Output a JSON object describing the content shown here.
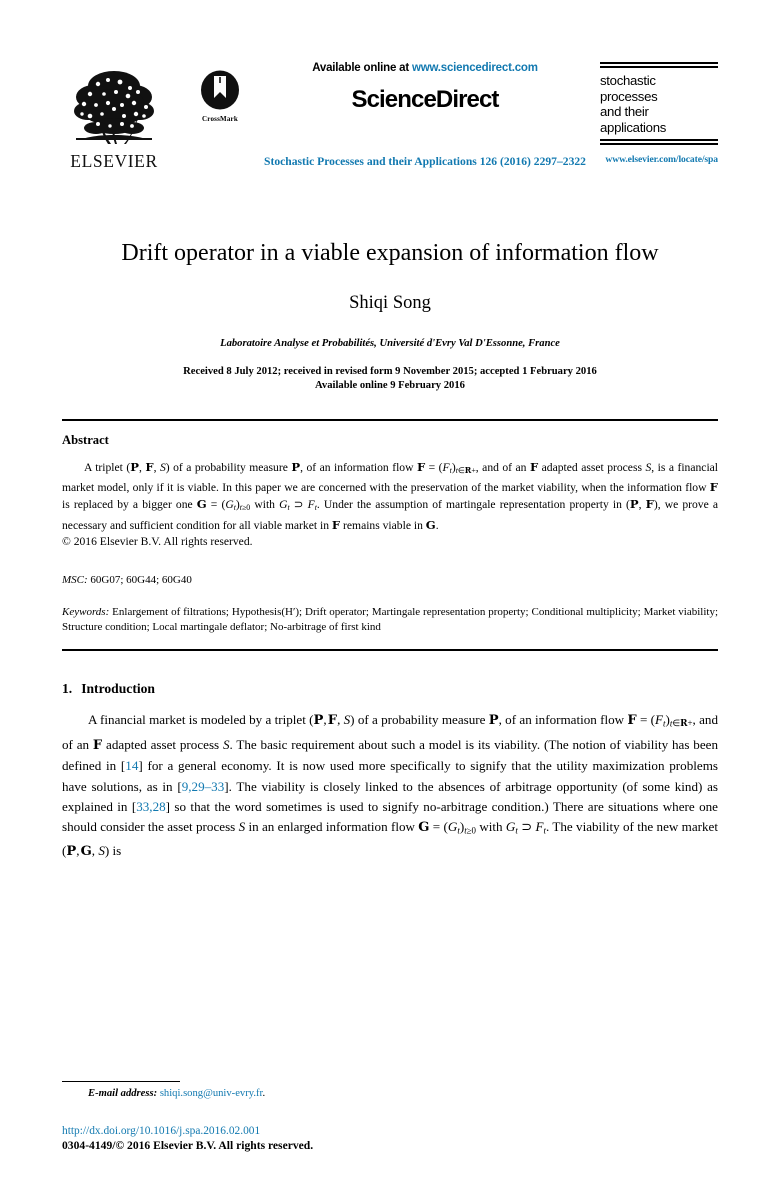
{
  "masthead": {
    "publisher_name": "ELSEVIER",
    "publisher_logo_icon": "elsevier-tree-logo",
    "crossmark_label": "CrossMark",
    "crossmark_icon": "crossmark-logo",
    "available_online_prefix": "Available online at ",
    "sciencedirect_url": "www.sciencedirect.com",
    "sciencedirect_logo": "ScienceDirect",
    "journal_ref": "Stochastic Processes and their Applications 126 (2016) 2297–2322",
    "journal_box_title": "stochastic processes and their applications",
    "journal_box_lines": [
      "stochastic",
      "processes",
      "and their",
      "applications"
    ],
    "journal_url": "www.elsevier.com/locate/spa"
  },
  "colors": {
    "link_blue": "#1279b0",
    "text_black": "#000000",
    "page_background": "#ffffff"
  },
  "title_block": {
    "title": "Drift operator in a viable expansion of information flow",
    "author": "Shiqi Song",
    "affiliation": "Laboratoire Analyse et Probabilités, Université d'Evry Val D'Essonne, France",
    "received_line": "Received 8 July 2012; received in revised form 9 November 2015; accepted 1 February 2016",
    "available_line": "Available online 9 February 2016"
  },
  "abstract": {
    "heading": "Abstract",
    "text_plain": "A triplet (P, F, S) of a probability measure P, of an information flow F = (Ft)t∈R+, and of an F adapted asset process S, is a financial market model, only if it is viable. In this paper we are concerned with the preservation of the market viability, when the information flow F is replaced by a bigger one G = (Gt)t≥0 with Gt ⊃ Ft. Under the assumption of martingale representation property in (P, F), we prove a necessary and sufficient condition for all viable market in F remains viable in G.",
    "copyright": "© 2016 Elsevier B.V. All rights reserved."
  },
  "msc": {
    "label": "MSC:",
    "value": "60G07; 60G44; 60G40"
  },
  "keywords": {
    "label": "Keywords:",
    "value": "Enlargement of filtrations; Hypothesis(H′); Drift operator; Martingale representation property; Conditional multiplicity; Market viability; Structure condition; Local martingale deflator; No-arbitrage of first kind"
  },
  "introduction": {
    "number": "1.",
    "heading": "Introduction",
    "paragraph_plain": "A financial market is modeled by a triplet (P, F, S) of a probability measure P, of an information flow F = (Ft)t∈R+, and of an F adapted asset process S. The basic requirement about such a model is its viability. (The notion of viability has been defined in [14] for a general economy. It is now used more specifically to signify that the utility maximization problems have solutions, as in [9,29–33]. The viability is closely linked to the absences of arbitrage opportunity (of some kind) as explained in [33,28] so that the word sometimes is used to signify no-arbitrage condition.) There are situations where one should consider the asset process S in an enlarged information flow G = (Gt)t≥0 with Gt ⊃ Ft. The viability of the new market (P, G, S) is",
    "citations": [
      "14",
      "9,29–33",
      "33,28"
    ]
  },
  "footer": {
    "email_label": "E-mail address:",
    "email_address": "shiqi.song@univ-evry.fr",
    "email_trailing": ".",
    "doi": "http://dx.doi.org/10.1016/j.spa.2016.02.001",
    "issn_line": "0304-4149/© 2016 Elsevier B.V. All rights reserved."
  }
}
